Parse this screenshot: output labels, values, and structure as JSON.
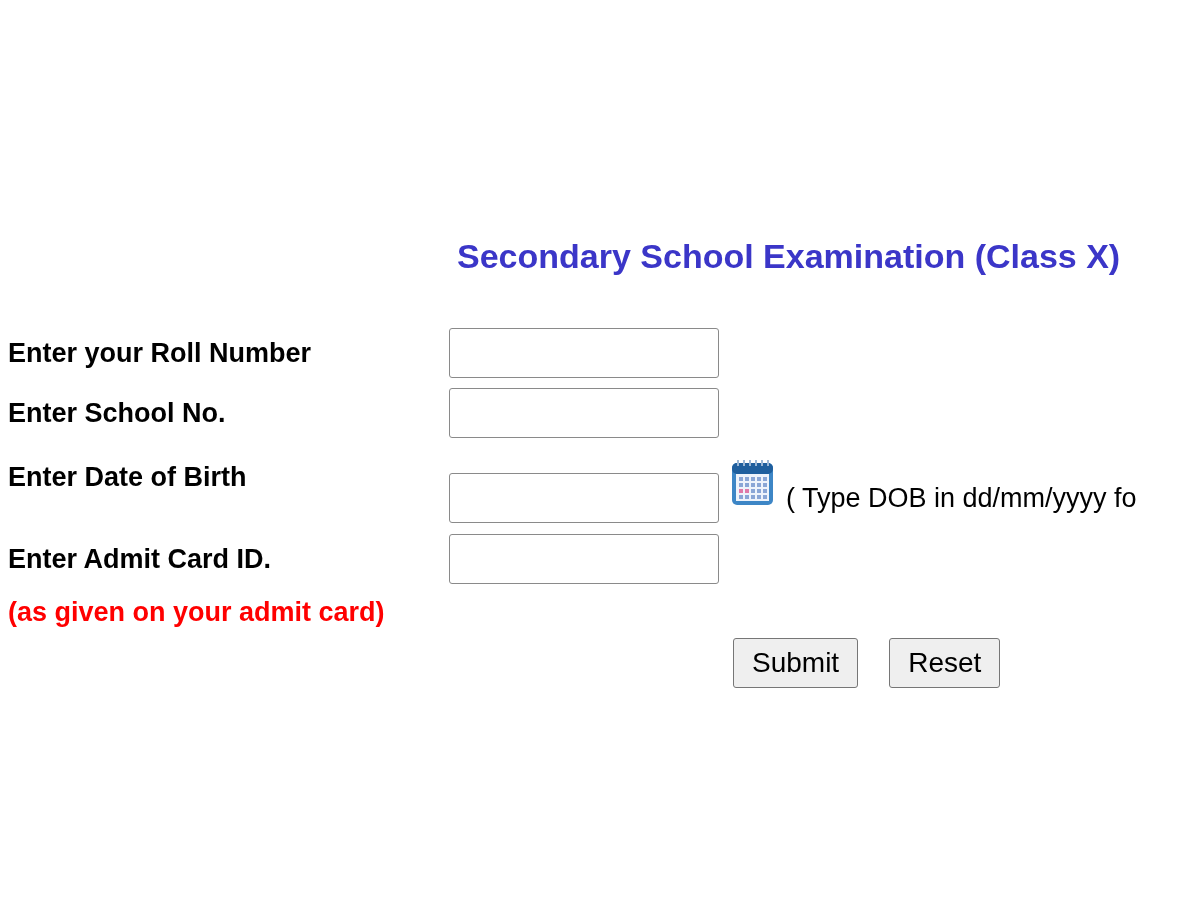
{
  "title": "Secondary School Examination (Class X)",
  "fields": [
    {
      "label": "Enter your Roll Number",
      "kind": "text"
    },
    {
      "label": "Enter School No.",
      "kind": "text"
    },
    {
      "label": "Enter Date of Birth",
      "kind": "date",
      "hint": "( Type DOB in dd/mm/yyyy fo"
    },
    {
      "label": "Enter Admit Card ID.",
      "kind": "text"
    }
  ],
  "note": "(as given on your admit card)",
  "buttons": [
    "Submit",
    "Reset"
  ]
}
